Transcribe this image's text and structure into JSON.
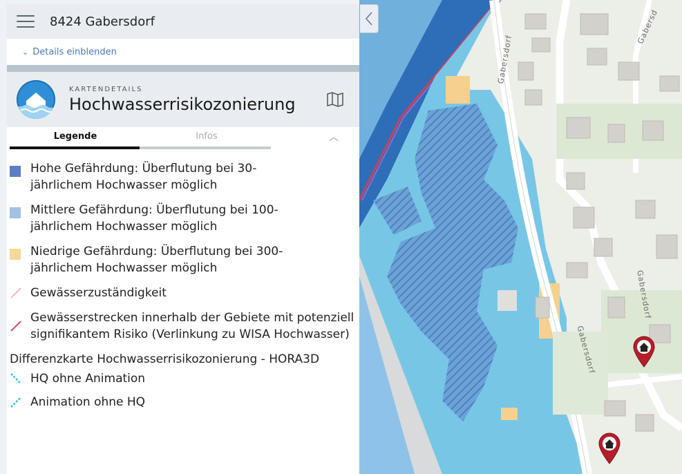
{
  "address": "8424 Gabersdorf",
  "details_label": "Details einblenden",
  "kicker": "KARTENDETAILS",
  "title": "Hochwasserrisikozonierung",
  "tabs": [
    {
      "label": "Legende",
      "active": true
    },
    {
      "label": "Infos",
      "active": false
    }
  ],
  "legend": [
    {
      "label": "Hohe Gefährdung: Überflutung bei 30-jährlichem Hochwasser möglich",
      "color": "#5b7ec4",
      "kind": "fill"
    },
    {
      "label": "Mittlere Gefährdung: Überflutung bei 100-jährlichem Hochwasser möglich",
      "color": "#9fc2e6",
      "kind": "fill"
    },
    {
      "label": "Niedrige Gefährdung: Überflutung bei 300-jährlichem Hochwasser möglich",
      "color": "#f7d79a",
      "kind": "fill"
    },
    {
      "label": "Gewässerzuständigkeit",
      "color": "#e9b9d6",
      "kind": "line"
    },
    {
      "label": "Gewässerstrecken innerhalb der Gebiete mit potenziell signifikantem Risiko (Verlinkung zu WISA Hochwasser)",
      "color": "#d64d6a",
      "kind": "line"
    }
  ],
  "section_title": "Differenzkarte Hochwasserrisikozonierung - HORA3D",
  "hq_items": [
    {
      "label": "HQ ohne Animation",
      "color": "#35c3d6"
    },
    {
      "label": "Animation ohne HQ",
      "color": "#35c3d6"
    }
  ],
  "map": {
    "street_labels": [
      "Gabersdorf",
      "Gabersdorf",
      "Gabersdorf",
      "Gabersd"
    ],
    "markers": [
      "home-marker",
      "home-marker"
    ]
  }
}
